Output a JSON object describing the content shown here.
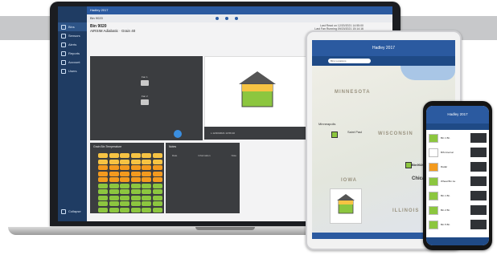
{
  "laptop": {
    "app_title": "Hadley 2017",
    "breadcrumb": "Bin 9020",
    "sidebar": [
      {
        "label": "Bins"
      },
      {
        "label": "Sensors"
      },
      {
        "label": "Alerts"
      },
      {
        "label": "Reports"
      },
      {
        "label": "Account"
      },
      {
        "label": "Users"
      },
      {
        "label": "Collapse"
      }
    ],
    "bin_title": "Bin 9020",
    "bin_subtitle": "AIRSIM Adiabatic · Grain 40",
    "last_read": "Last Read on 12/20/2021 14:55:00",
    "last_moving": "Last Fan Running 09/20/2021 15:14:16",
    "fan1_label": "Fan 1",
    "fan2_label": "Fan 2",
    "status_text": "L 12/20/2021 14:56:10",
    "temp_panel_title": "Grain Bin Temperature",
    "notes_panel_title": "Notes",
    "notes_columns": [
      "Date",
      "Information",
      "Note"
    ]
  },
  "tablet": {
    "title": "Hadley 2017",
    "search_placeholder": "Bins Locations",
    "map_labels": [
      "MINNESOTA",
      "WISCONSIN",
      "IOWA",
      "ILLINOIS"
    ],
    "cities": [
      "Minneapolis",
      "Saint Paul",
      "Chicago"
    ],
    "pin_label": "Bin9020"
  },
  "phone": {
    "title": "Hadley 2017",
    "rows": [
      {
        "name": "Bin 1 Bn",
        "sub": "AIRSIM Grain"
      },
      {
        "name": "BIS Internal",
        "sub": "Grain"
      },
      {
        "name": "Radar",
        "sub": ""
      },
      {
        "name": "Wheat Bin 1a",
        "sub": "Grain"
      },
      {
        "name": "Bin 1 Bn",
        "sub": ""
      },
      {
        "name": "Bin 2 Bn",
        "sub": ""
      },
      {
        "name": "Bin 5 Bn",
        "sub": ""
      }
    ]
  },
  "colors": {
    "brand": "#2b5aa0",
    "sidebar": "#1f3c63",
    "dark_panel": "#3b3d40",
    "grain_green": "#8cc63f",
    "grain_orange": "#f39a1e",
    "grain_yellow": "#f6c343"
  }
}
